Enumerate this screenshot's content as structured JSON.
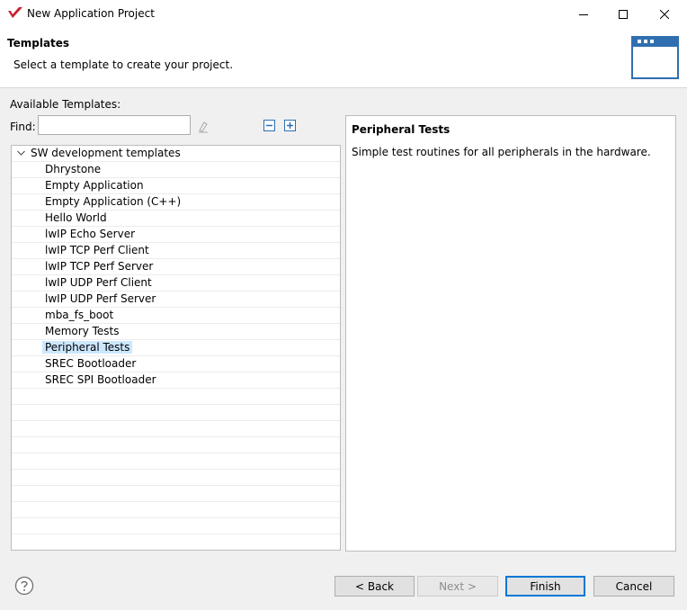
{
  "window": {
    "title": "New Application Project",
    "controls": [
      "minimize",
      "maximize",
      "close"
    ]
  },
  "banner": {
    "title": "Templates",
    "description": "Select a template to create your project."
  },
  "templates": {
    "available_label": "Available Templates:",
    "find_label": "Find:",
    "find_value": "",
    "root": "SW development templates",
    "items": [
      "Dhrystone",
      "Empty Application",
      "Empty Application (C++)",
      "Hello World",
      "lwIP Echo Server",
      "lwIP TCP Perf Client",
      "lwIP TCP Perf Server",
      "lwIP UDP Perf Client",
      "lwIP UDP Perf Server",
      "mba_fs_boot",
      "Memory Tests",
      "Peripheral Tests",
      "SREC Bootloader",
      "SREC SPI Bootloader"
    ],
    "selected": "Peripheral Tests"
  },
  "detail": {
    "title": "Peripheral Tests",
    "description": "Simple test routines for all peripherals in the hardware."
  },
  "footer": {
    "back_label": "< Back",
    "next_label": "Next >",
    "finish_label": "Finish",
    "cancel_label": "Cancel"
  },
  "colors": {
    "selection": "#cce8ff",
    "accent": "#0078d7",
    "logo": "#c8202f"
  }
}
